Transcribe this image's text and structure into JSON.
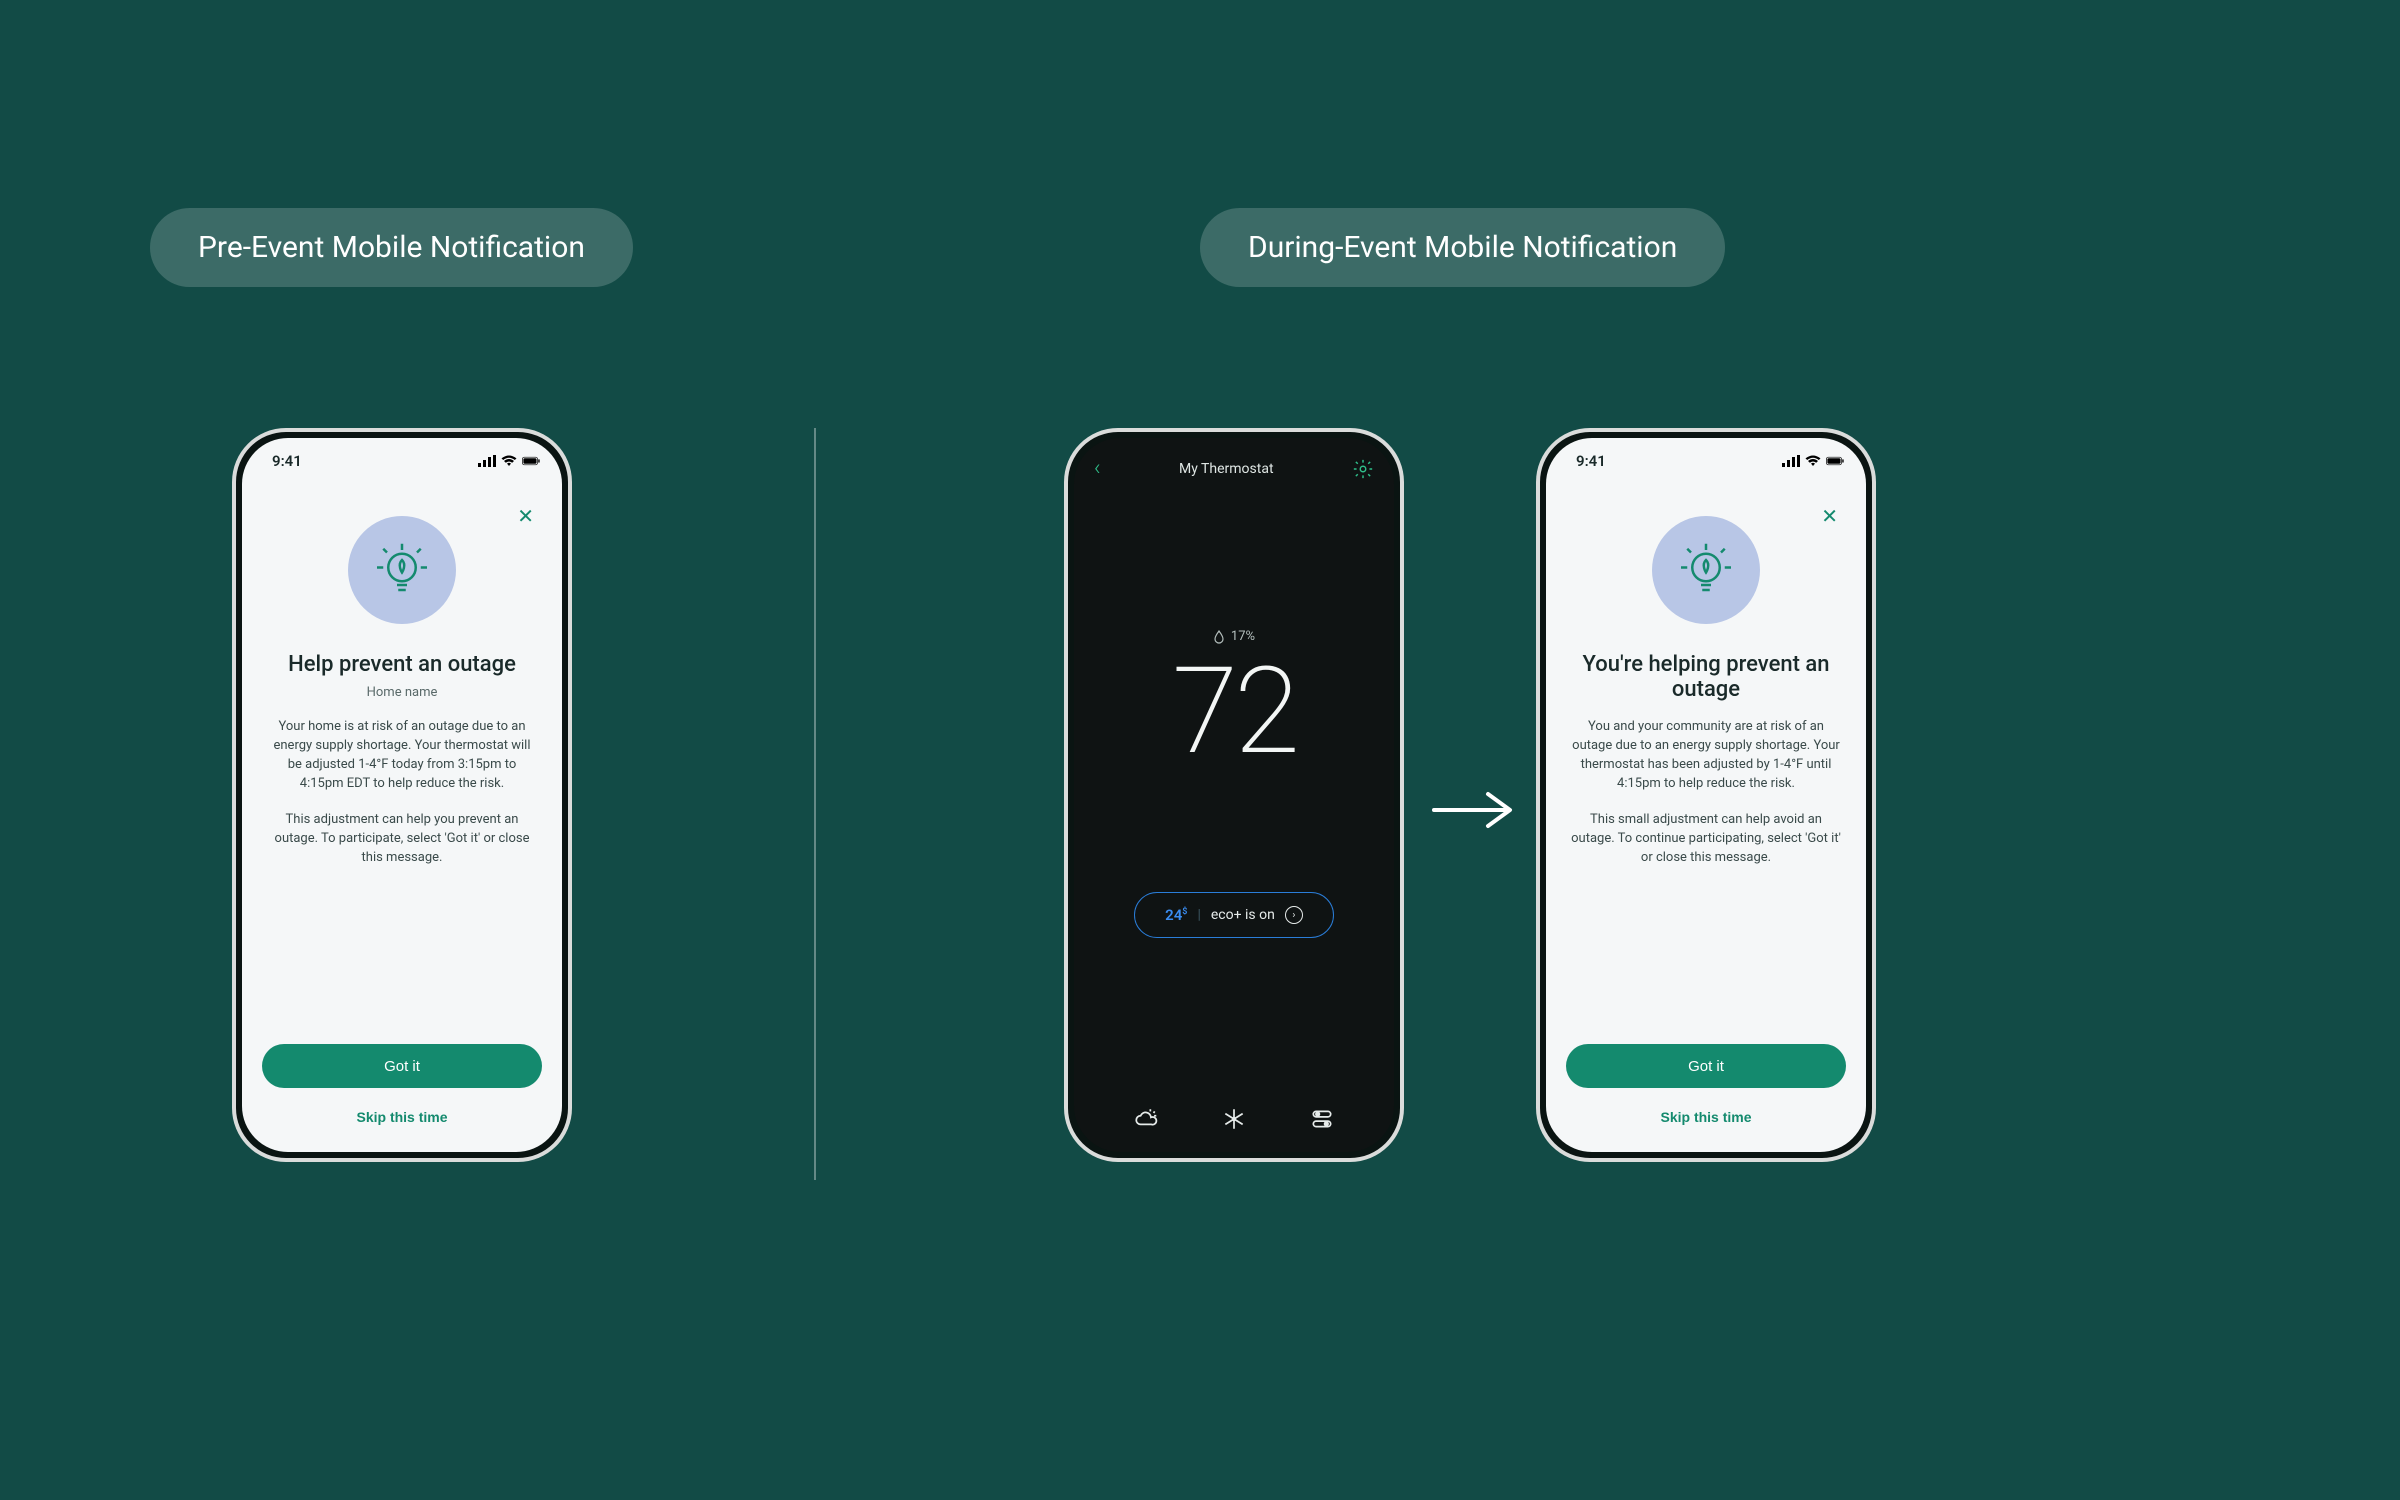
{
  "labels": {
    "pre": "Pre-Event Mobile Notification",
    "during": "During-Event Mobile Notification"
  },
  "statusbar": {
    "time": "9:41"
  },
  "preModal": {
    "title": "Help prevent an outage",
    "subhead": "Home name",
    "para1": "Your home is at risk of an outage due to an energy supply shortage. Your thermostat will be adjusted 1-4°F today from 3:15pm to 4:15pm EDT to help reduce the risk.",
    "para2": "This adjustment can help you prevent an outage. To participate, select 'Got it' or close this message.",
    "primary": "Got it",
    "skip": "Skip this time"
  },
  "thermo": {
    "title": "My Thermostat",
    "humidity": "17%",
    "temp": "72",
    "savings": "24",
    "savings_unit": "$",
    "eco_label": "eco+ is on"
  },
  "duringModal": {
    "title": "You're helping prevent an outage",
    "para1": "You and your community are at risk of an outage due to an energy supply shortage. Your thermostat has been adjusted by 1-4°F until 4:15pm to help reduce the risk.",
    "para2": "This small adjustment can help avoid an outage. To continue participating, select 'Got it' or close this message.",
    "primary": "Got it",
    "skip": "Skip this time"
  }
}
